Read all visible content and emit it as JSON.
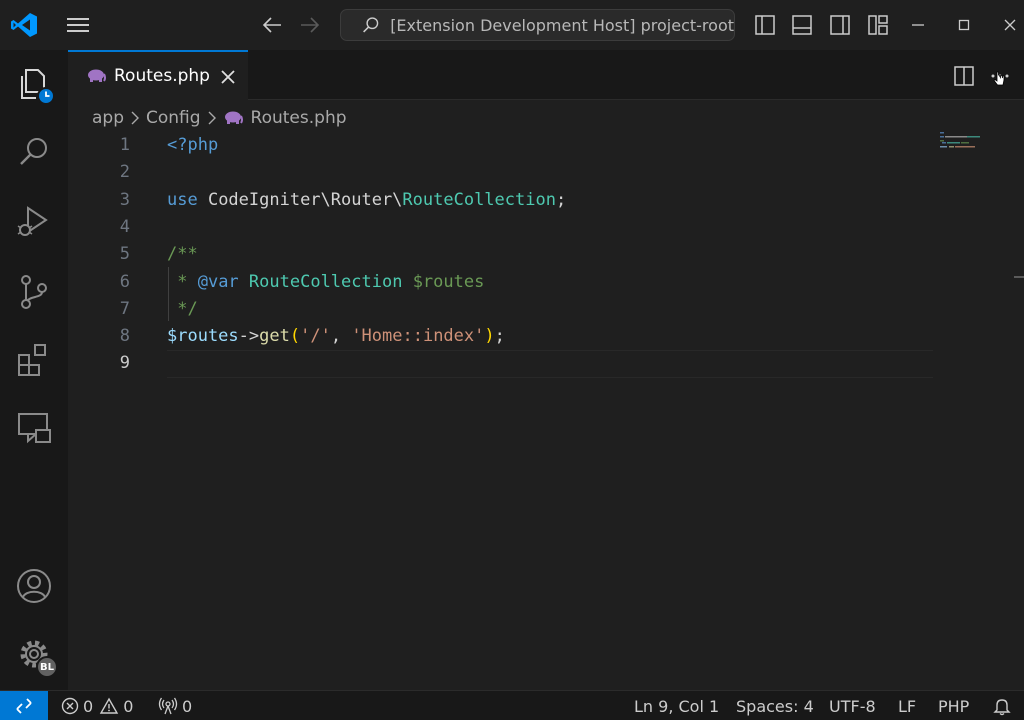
{
  "titlebar": {
    "search_text": "[Extension Development Host] project-root"
  },
  "tabs": [
    {
      "label": "Routes.php",
      "active": true
    }
  ],
  "breadcrumb": {
    "items": [
      "app",
      "Config",
      "Routes.php"
    ]
  },
  "editor": {
    "line_numbers": [
      "1",
      "2",
      "3",
      "4",
      "5",
      "6",
      "7",
      "8",
      "9"
    ],
    "active_line": "9",
    "lines": [
      [
        {
          "t": "<?php",
          "c": "tag"
        }
      ],
      [],
      [
        {
          "t": "use ",
          "c": "kw"
        },
        {
          "t": "CodeIgniter\\Router\\",
          "c": "id"
        },
        {
          "t": "RouteCollection",
          "c": "cls"
        },
        {
          "t": ";",
          "c": "id"
        }
      ],
      [],
      [
        {
          "t": "/**",
          "c": "cm"
        }
      ],
      [
        {
          "t": " * ",
          "c": "cm"
        },
        {
          "t": "@var",
          "c": "doctag"
        },
        {
          "t": " ",
          "c": "cm"
        },
        {
          "t": "RouteCollection",
          "c": "cls"
        },
        {
          "t": " $routes",
          "c": "cm"
        }
      ],
      [
        {
          "t": " */",
          "c": "cm"
        }
      ],
      [
        {
          "t": "$routes",
          "c": "var"
        },
        {
          "t": "->",
          "c": "id"
        },
        {
          "t": "get",
          "c": "fn"
        },
        {
          "t": "(",
          "c": "br"
        },
        {
          "t": "'/'",
          "c": "str"
        },
        {
          "t": ", ",
          "c": "id"
        },
        {
          "t": "'Home::index'",
          "c": "str"
        },
        {
          "t": ")",
          "c": "br"
        },
        {
          "t": ";",
          "c": "id"
        }
      ],
      []
    ]
  },
  "statusbar": {
    "errors": "0",
    "warnings": "0",
    "ports": "0",
    "cursor_position": "Ln 9, Col 1",
    "indentation": "Spaces: 4",
    "encoding": "UTF-8",
    "eol": "LF",
    "language": "PHP"
  },
  "account_badge": "BL",
  "colors": {
    "accent": "#0078d4",
    "php_icon": "#a074c4"
  },
  "icons": {
    "logo": "vscode-logo-icon",
    "menu": "hamburger-menu-icon",
    "back": "arrow-left-icon",
    "forward": "arrow-right-icon",
    "search": "search-icon",
    "explorer": "explorer-icon",
    "run_debug": "run-debug-icon",
    "source_control": "source-control-icon",
    "extensions": "extensions-icon",
    "remote_explorer": "remote-explorer-icon",
    "accounts": "account-icon",
    "manage": "gear-icon"
  }
}
